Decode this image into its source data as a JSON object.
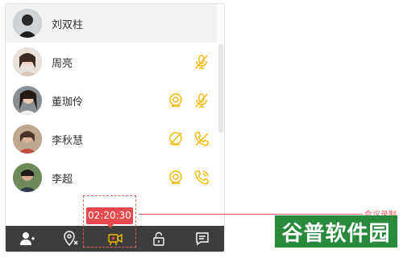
{
  "contacts": [
    {
      "name": "刘双柱",
      "active": true,
      "icons": []
    },
    {
      "name": "周亮",
      "active": false,
      "icons": [
        "mic-muted-icon"
      ]
    },
    {
      "name": "董珈伶",
      "active": false,
      "icons": [
        "camera-icon",
        "mic-muted-icon"
      ]
    },
    {
      "name": "李秋慧",
      "active": false,
      "icons": [
        "camera-off-icon",
        "phone-off-icon"
      ]
    },
    {
      "name": "李超",
      "active": false,
      "icons": [
        "camera-icon",
        "phone-ringing-icon"
      ]
    }
  ],
  "toolbar": {
    "buttons": [
      "add-user-icon",
      "location-cancel-icon",
      "record-video-icon",
      "unlock-icon",
      "chat-icon"
    ],
    "active": "record-video-icon"
  },
  "recording": {
    "timer": "02:20:30"
  },
  "annotation": {
    "text": "会议录制"
  },
  "watermark": {
    "text": "谷普软件园"
  },
  "colors": {
    "accent": "#f5b800",
    "record": "#e5484d",
    "toolbar_bg": "#3d3d3d",
    "watermark_bg": "#2a8a3c"
  }
}
